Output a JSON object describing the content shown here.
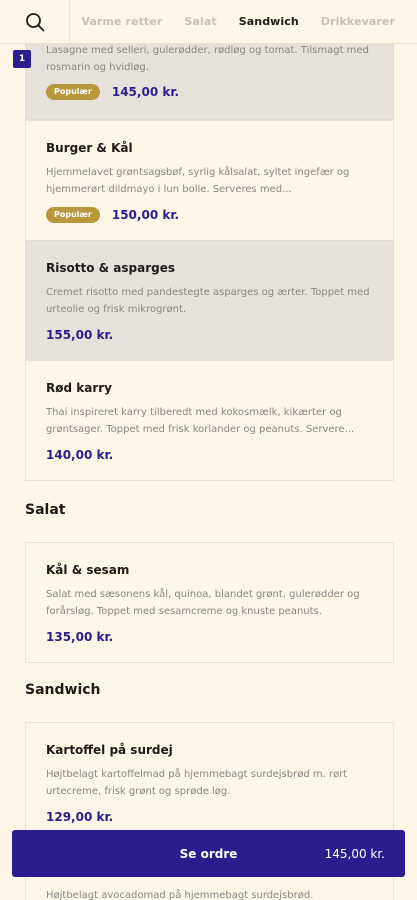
{
  "nav": {
    "tabs": [
      "Varme retter",
      "Salat",
      "Sandwich",
      "Drikkevarer"
    ],
    "active_tab": "Sandwich"
  },
  "cart_count": "1",
  "items": [
    {
      "desc": "Lasagne med selleri, gulerødder, rødløg og tomat. Tilsmagt med rosmarin og hvidløg.",
      "badge": "Populær",
      "price": "145,00 kr."
    },
    {
      "name": "Burger & Kål",
      "desc": "Hjemmelavet grøntsagsbøf, syrlig kålsalat, syltet ingefær og hjemmerørt dildmayo i lun bolle. Serveres med...",
      "badge": "Populær",
      "price": "150,00 kr."
    },
    {
      "name": "Risotto & asparges",
      "desc": "Cremet risotto med pandestegte asparges og ærter. Toppet med urteolie og frisk mikrogrønt.",
      "price": "155,00 kr."
    },
    {
      "name": "Rød karry",
      "desc": "Thai inspireret karry tilberedt med kokosmælk, kikærter og grøntsager. Toppet med frisk koriander og peanuts. Servere...",
      "price": "140,00 kr."
    }
  ],
  "sections": [
    {
      "title": "Salat",
      "items": [
        {
          "name": "Kål & sesam",
          "desc": "Salat med sæsonens kål, quinoa, blandet grønt, gulerødder og forårsløg. Toppet med sesamcreme og knuste peanuts.",
          "price": "135,00 kr."
        }
      ]
    },
    {
      "title": "Sandwich",
      "items": [
        {
          "name": "Kartoffel på surdej",
          "desc": "Højtbelagt kartoffelmad på hjemmebagt surdejsbrød m. rørt urtecreme, frisk grønt og sprøde løg.",
          "price": "129,00 kr."
        },
        {
          "desc": "Højtbelagt avocadomad på hjemmebagt surdejsbrød."
        }
      ]
    }
  ],
  "order_bar": {
    "label": "Se ordre",
    "total": "145,00 kr."
  },
  "colors": {
    "background": "#fdf5e6",
    "accent": "#2b1d8e",
    "badge": "#b8973e",
    "selected": "#e7e1dc"
  }
}
